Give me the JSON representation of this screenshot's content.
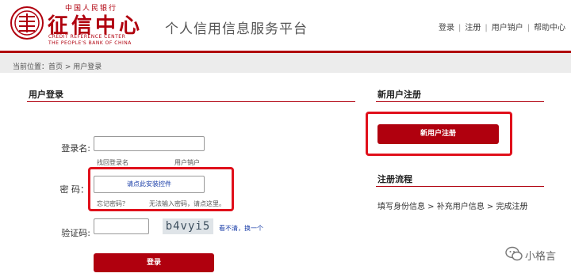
{
  "header": {
    "logo_top_text": "中国人民银行",
    "logo_main_text": "征信中心",
    "logo_en_line1": "CREDIT REFERENCE CENTER",
    "logo_en_line2": "THE PEOPLE'S BANK OF CHINA",
    "platform_title": "个人信用信息服务平台",
    "nav": [
      "登录",
      "注册",
      "用户销户",
      "帮助中心"
    ],
    "nav_separator": "|",
    "brand_color": "#b0000e"
  },
  "breadcrumb": {
    "prefix": "当前位置：",
    "home": "首页",
    "separator": " > ",
    "current": "用户登录"
  },
  "login": {
    "section_title": "用户登录",
    "username_label": "登录名:",
    "username_value": "",
    "forgot_username": "找回登录名",
    "cancel_account": "用户销户",
    "password_label": "密  码：",
    "password_plugin_prompt": "请点此安装控件",
    "forgot_password": "忘记密码？",
    "cannot_input_prefix": "无法输入密码，",
    "cannot_input_link": "请点这里。",
    "captcha_label": "验证码:",
    "captcha_value": "",
    "captcha_image_text": "b4vyi5",
    "captcha_refresh": "看不清，换一个",
    "login_button": "登录"
  },
  "register": {
    "section_title": "新用户注册",
    "register_button": "新用户注册",
    "process_title": "注册流程",
    "process_steps": "填写身份信息 > 补充用户信息 > 完成注册"
  },
  "watermark": {
    "text": "小格言"
  },
  "colors": {
    "accent": "#b0000e",
    "highlight": "#e0101b",
    "link_blue": "#1a3ea8"
  }
}
